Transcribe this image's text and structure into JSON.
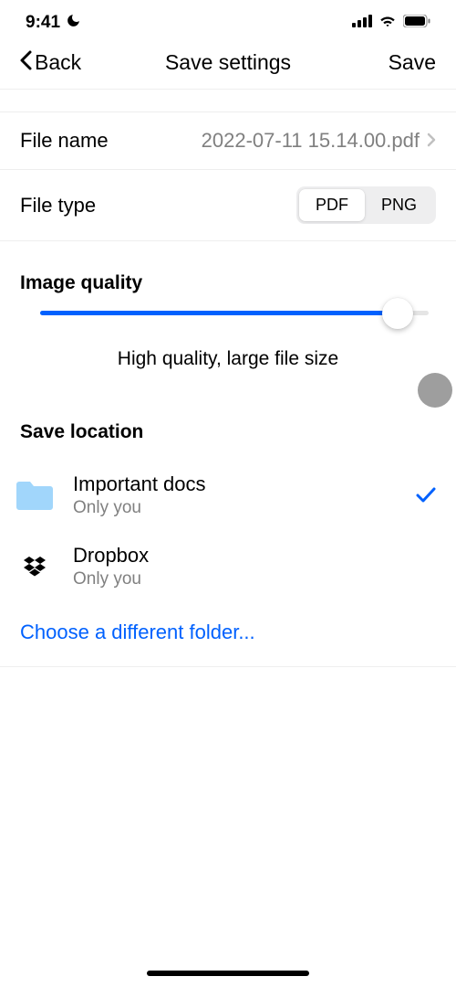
{
  "status_bar": {
    "time": "9:41"
  },
  "nav": {
    "back_label": "Back",
    "title": "Save settings",
    "save_label": "Save"
  },
  "file": {
    "name_label": "File name",
    "name_value": "2022-07-11 15.14.00.pdf",
    "type_label": "File type",
    "type_options": {
      "pdf": "PDF",
      "png": "PNG"
    },
    "type_selected": "pdf"
  },
  "quality": {
    "header": "Image quality",
    "value_percent": 92,
    "caption": "High quality, large file size"
  },
  "location": {
    "header": "Save location",
    "items": [
      {
        "title": "Important docs",
        "subtitle": "Only you",
        "selected": true,
        "icon": "folder"
      },
      {
        "title": "Dropbox",
        "subtitle": "Only you",
        "selected": false,
        "icon": "dropbox"
      }
    ],
    "choose_label": "Choose a different folder..."
  }
}
